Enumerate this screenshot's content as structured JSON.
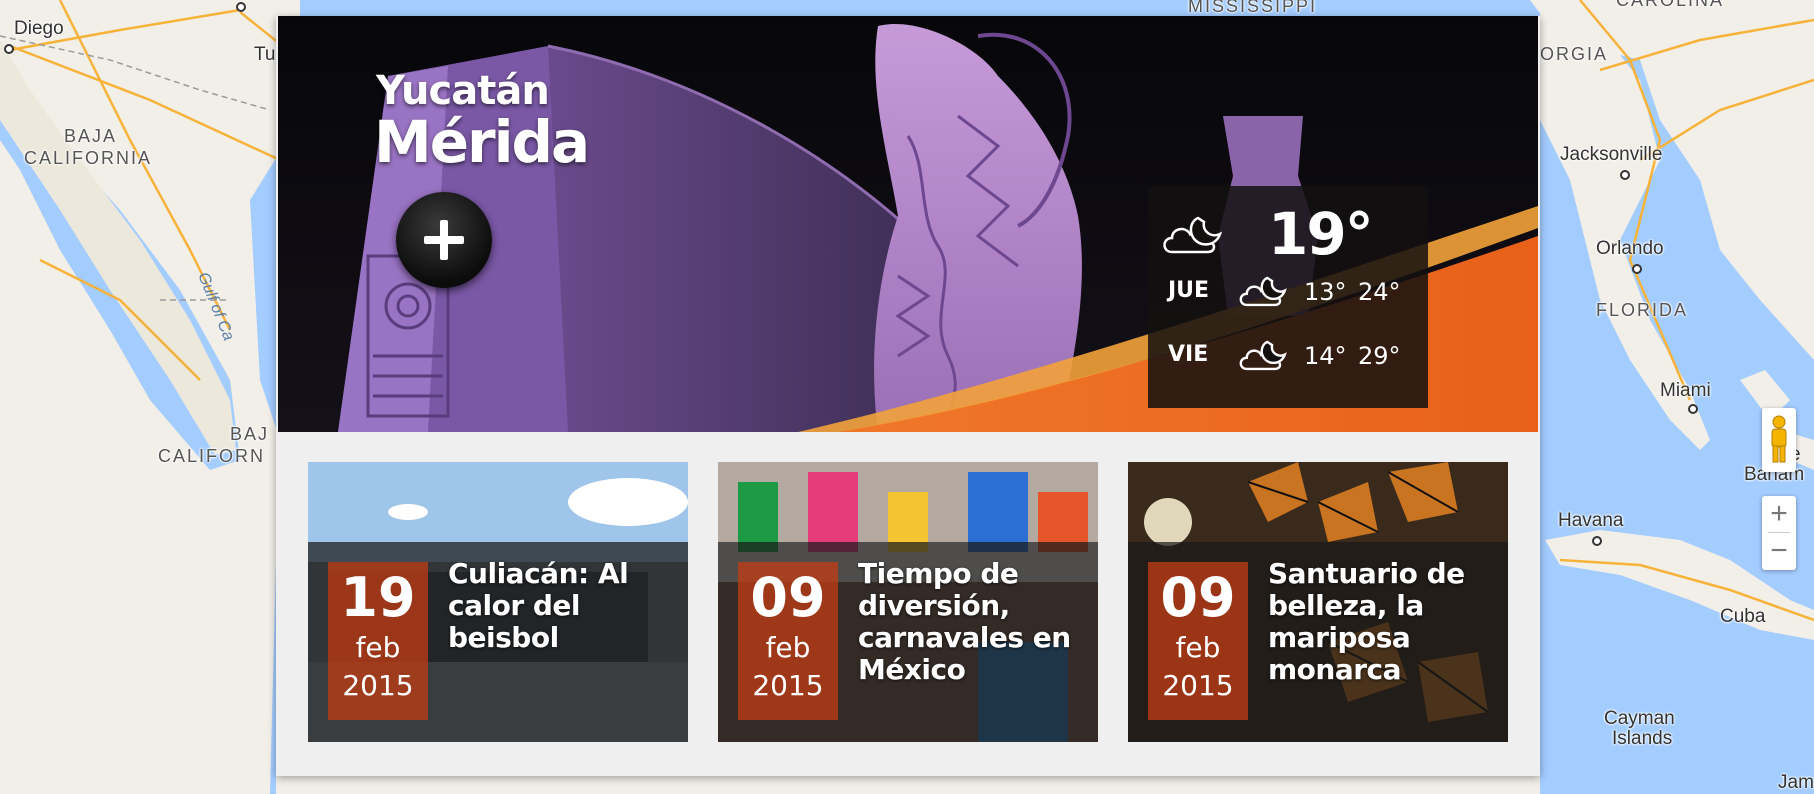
{
  "map": {
    "labels": [
      {
        "text": "Diego",
        "kind": "city"
      },
      {
        "text": "BAJA",
        "kind": "region"
      },
      {
        "text": "CALIFORNIA",
        "kind": "region"
      },
      {
        "text": "Gulf of Ca",
        "kind": "water"
      },
      {
        "text": "BAJ",
        "kind": "region"
      },
      {
        "text": "CALIFORN",
        "kind": "region"
      },
      {
        "text": "Tu",
        "kind": "city"
      },
      {
        "text": "MISSISSIPPI",
        "kind": "region"
      },
      {
        "text": "CAROLINA",
        "kind": "region"
      },
      {
        "text": "ORGIA",
        "kind": "region"
      },
      {
        "text": "Jacksonville",
        "kind": "city"
      },
      {
        "text": "Orlando",
        "kind": "city"
      },
      {
        "text": "FLORIDA",
        "kind": "region"
      },
      {
        "text": "Miami",
        "kind": "city"
      },
      {
        "text": "Havana",
        "kind": "city"
      },
      {
        "text": "Cuba",
        "kind": "city"
      },
      {
        "text": "Cayman",
        "kind": "city"
      },
      {
        "text": "Islands",
        "kind": "city"
      },
      {
        "text": "e",
        "kind": "city"
      },
      {
        "text": "Baham",
        "kind": "city"
      },
      {
        "text": "Jam",
        "kind": "city"
      }
    ],
    "controls": {
      "pegman_icon": "street-view-pegman-icon",
      "zoom_in": "+",
      "zoom_out": "−"
    },
    "colors": {
      "water": "#a3ccff",
      "land": "#f2efe9",
      "road": "#f7b23a"
    }
  },
  "hero": {
    "state": "Yucatán",
    "city": "Mérida",
    "more_icon": "plus-icon",
    "colors": {
      "accent": "#e8601a",
      "overlay": "#141010"
    }
  },
  "weather": {
    "current": {
      "icon": "moon-cloud-icon",
      "temp": "19°"
    },
    "forecast": [
      {
        "day": "JUE",
        "icon": "moon-cloud-icon",
        "low": "13°",
        "high": "24°"
      },
      {
        "day": "VIE",
        "icon": "moon-cloud-icon",
        "low": "14°",
        "high": "29°"
      }
    ]
  },
  "cards": [
    {
      "day": "19",
      "month": "feb",
      "year": "2015",
      "title": "Culiacán: Al calor del beisbol"
    },
    {
      "day": "09",
      "month": "feb",
      "year": "2015",
      "title": "Tiempo de diversión, carnavales en México"
    },
    {
      "day": "09",
      "month": "feb",
      "year": "2015",
      "title": "Santuario de belleza, la mariposa monarca"
    }
  ]
}
